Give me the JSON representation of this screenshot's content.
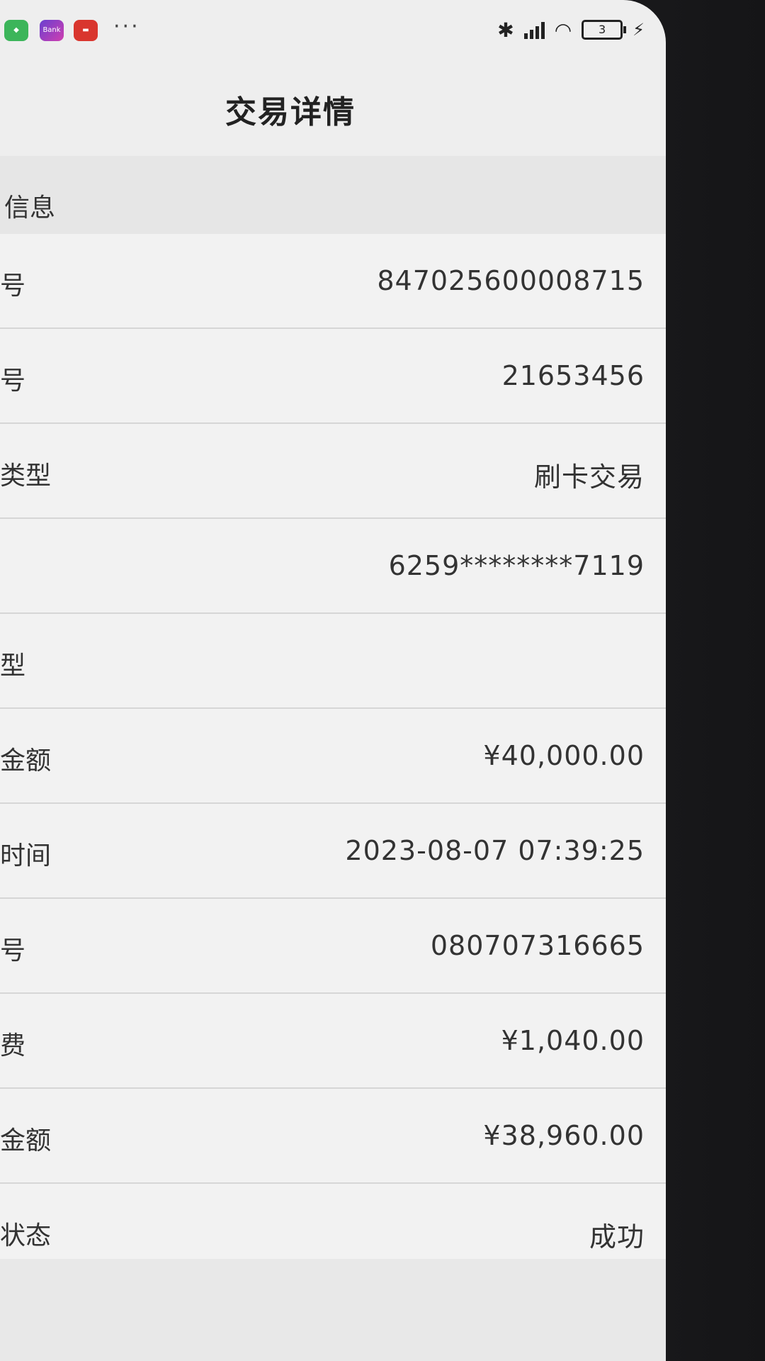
{
  "status_bar": {
    "icons": [
      "shield-app-icon",
      "bank-app-icon",
      "red-app-icon"
    ],
    "icon_texts": [
      "",
      "Bank",
      ""
    ],
    "more": "···",
    "battery": "3",
    "bluetooth": "bluetooth-icon",
    "signal": "signal-icon",
    "wifi": "wifi-icon",
    "charging": "charging-icon"
  },
  "nav": {
    "title": "交易详情"
  },
  "section": {
    "title": "信息"
  },
  "rows": [
    {
      "label": "号",
      "value": "847025600008715"
    },
    {
      "label": "号",
      "value": "21653456"
    },
    {
      "label": "类型",
      "value": "刷卡交易"
    },
    {
      "label": "",
      "value": "6259********7119"
    },
    {
      "label": "型",
      "value": ""
    },
    {
      "label": "金额",
      "value": "¥40,000.00"
    },
    {
      "label": "时间",
      "value": "2023-08-07 07:39:25"
    },
    {
      "label": "号",
      "value": "080707316665"
    },
    {
      "label": "费",
      "value": "¥1,040.00"
    },
    {
      "label": "金额",
      "value": "¥38,960.00"
    },
    {
      "label": "状态",
      "value": "成功"
    }
  ],
  "colors": {
    "background": "#eeeeee",
    "text": "#333333",
    "divider": "#d6d6d6"
  }
}
